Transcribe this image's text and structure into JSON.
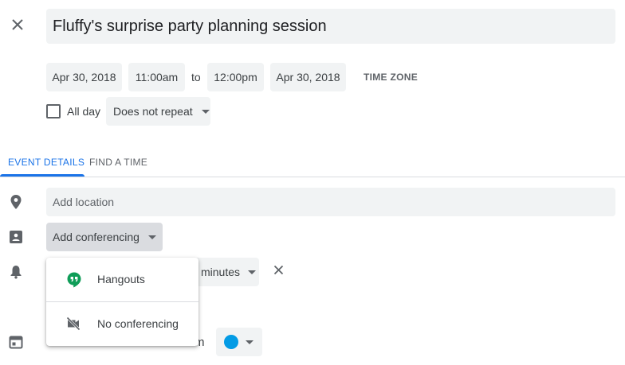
{
  "event": {
    "title": "Fluffy's surprise party planning session",
    "start_date": "Apr 30, 2018",
    "start_time": "11:00am",
    "to_label": "to",
    "end_time": "12:00pm",
    "end_date": "Apr 30, 2018",
    "time_zone_label": "TIME ZONE",
    "all_day_label": "All day",
    "all_day_checked": false,
    "repeat_value": "Does not repeat"
  },
  "tabs": [
    {
      "label": "EVENT DETAILS",
      "active": true
    },
    {
      "label": "FIND A TIME",
      "active": false
    }
  ],
  "details": {
    "location_placeholder": "Add location",
    "conferencing_label": "Add conferencing",
    "notification_unit": "minutes",
    "calendar_owner_partial": "m",
    "calendar_color": "#039be5"
  },
  "conferencing_menu": {
    "items": [
      {
        "label": "Hangouts",
        "icon": "hangouts-icon"
      },
      {
        "label": "No conferencing",
        "icon": "videocam-off-icon"
      }
    ]
  },
  "colors": {
    "accent": "#1a73e8",
    "hangouts_green": "#0f9d58"
  }
}
